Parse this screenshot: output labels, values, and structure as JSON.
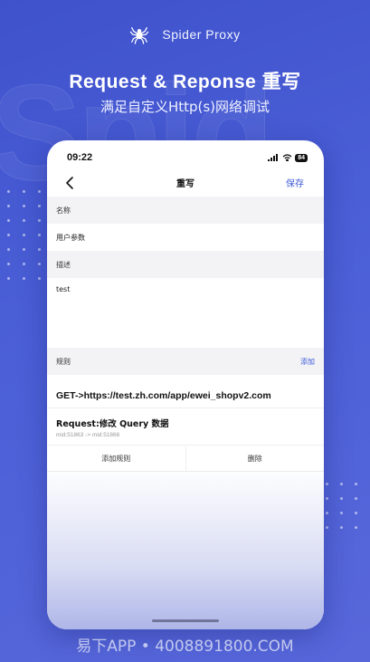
{
  "brand": {
    "name": "Spider Proxy",
    "icon": "spider-icon"
  },
  "headline": "Request & Reponse 重写",
  "subline": "满足自定义Http(s)网络调试",
  "phone": {
    "status": {
      "time": "09:22",
      "battery": "84"
    },
    "nav": {
      "title": "重写",
      "save_label": "保存",
      "back_icon": "chevron-left-icon"
    },
    "name_section": {
      "label": "名称",
      "value": "用户参数"
    },
    "desc_section": {
      "label": "描述",
      "value": "test"
    },
    "rules_section": {
      "label": "规则",
      "add_label": "添加",
      "url_rule": "GET->https://test.zh.com/app/ewei_shopv2.com",
      "request_rule": {
        "title": "Request:修改 Query 数据",
        "detail": "mid:51863 -> mid:51866"
      }
    },
    "actions": {
      "add_rule": "添加规则",
      "delete": "删除"
    }
  },
  "footer": "易下APP • 4008891800.COM",
  "colors": {
    "accent": "#3d5ad8",
    "background": "#4a5ed6"
  }
}
